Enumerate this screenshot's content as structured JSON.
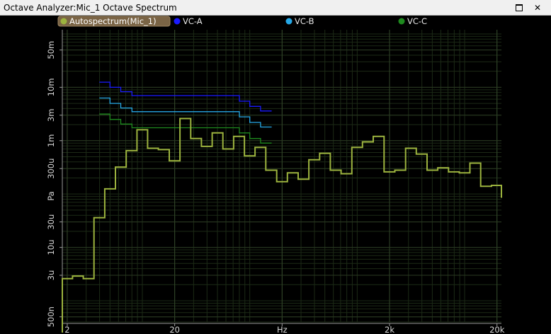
{
  "window": {
    "title": "Octave Analyzer:Mic_1 Octave Spectrum",
    "maximize_label": "",
    "close_label": "✕"
  },
  "legend": [
    {
      "label": "Autospectrum(Mic_1)",
      "color": "#9cb33e",
      "selected": true
    },
    {
      "label": "VC-A",
      "color": "#1a1aff",
      "selected": false
    },
    {
      "label": "VC-B",
      "color": "#26a9e8",
      "selected": false
    },
    {
      "label": "VC-C",
      "color": "#1e8a1e",
      "selected": false
    }
  ],
  "chart_data": {
    "type": "line",
    "xlabel": "Hz",
    "ylabel": "Pa",
    "x_scale": "log",
    "y_scale": "log",
    "xlim": [
      1.8,
      22000
    ],
    "ylim": [
      4e-07,
      0.12
    ],
    "x_ticks": [
      {
        "value": 2,
        "label": "2"
      },
      {
        "value": 20,
        "label": "20"
      },
      {
        "value": 200,
        "label": "Hz"
      },
      {
        "value": 2000,
        "label": "2k"
      },
      {
        "value": 20000,
        "label": "20k"
      }
    ],
    "y_ticks": [
      {
        "value": 0.05,
        "label": "50m"
      },
      {
        "value": 0.01,
        "label": "10m"
      },
      {
        "value": 0.003,
        "label": "3m"
      },
      {
        "value": 0.001,
        "label": "1m"
      },
      {
        "value": 0.0003,
        "label": "300u"
      },
      {
        "value": 3e-05,
        "label": "30u"
      },
      {
        "value": 1e-05,
        "label": "10u"
      },
      {
        "value": 3e-06,
        "label": "3u"
      },
      {
        "value": 5e-07,
        "label": "500n"
      }
    ],
    "grid": true,
    "legend_position": "top",
    "series": [
      {
        "name": "Autospectrum(Mic_1)",
        "color": "#9cb33e",
        "points": [
          [
            1.78,
            2.5e-07
          ],
          [
            1.78,
            2.6e-06
          ],
          [
            2.24,
            2.6e-06
          ],
          [
            2.24,
            2.9e-06
          ],
          [
            2.82,
            2.9e-06
          ],
          [
            2.82,
            2.6e-06
          ],
          [
            3.55,
            2.6e-06
          ],
          [
            3.55,
            3.6e-05
          ],
          [
            4.47,
            3.6e-05
          ],
          [
            4.47,
            0.000125
          ],
          [
            5.62,
            0.000125
          ],
          [
            5.62,
            0.00032
          ],
          [
            7.08,
            0.00032
          ],
          [
            7.08,
            0.00065
          ],
          [
            8.91,
            0.00065
          ],
          [
            8.91,
            0.0016
          ],
          [
            11.2,
            0.0016
          ],
          [
            11.2,
            0.00072
          ],
          [
            14.1,
            0.00072
          ],
          [
            14.1,
            0.00068
          ],
          [
            17.8,
            0.00068
          ],
          [
            17.8,
            0.00042
          ],
          [
            22.4,
            0.00042
          ],
          [
            22.4,
            0.0026
          ],
          [
            28.2,
            0.0026
          ],
          [
            28.2,
            0.0011
          ],
          [
            35.5,
            0.0011
          ],
          [
            35.5,
            0.00078
          ],
          [
            44.7,
            0.00078
          ],
          [
            44.7,
            0.0014
          ],
          [
            56.2,
            0.0014
          ],
          [
            56.2,
            0.0007
          ],
          [
            70.8,
            0.0007
          ],
          [
            70.8,
            0.0012
          ],
          [
            89.1,
            0.0012
          ],
          [
            89.1,
            0.00052
          ],
          [
            112,
            0.00052
          ],
          [
            112,
            0.00075
          ],
          [
            141,
            0.00075
          ],
          [
            141,
            0.00028
          ],
          [
            178,
            0.00028
          ],
          [
            178,
            0.00017
          ],
          [
            224,
            0.00017
          ],
          [
            224,
            0.00025
          ],
          [
            282,
            0.00025
          ],
          [
            282,
            0.00019
          ],
          [
            355,
            0.00019
          ],
          [
            355,
            0.00044
          ],
          [
            447,
            0.00044
          ],
          [
            447,
            0.00058
          ],
          [
            562,
            0.00058
          ],
          [
            562,
            0.00028
          ],
          [
            708,
            0.00028
          ],
          [
            708,
            0.00024
          ],
          [
            891,
            0.00024
          ],
          [
            891,
            0.00075
          ],
          [
            1120,
            0.00075
          ],
          [
            1120,
            0.00095
          ],
          [
            1410,
            0.00095
          ],
          [
            1410,
            0.0012
          ],
          [
            1780,
            0.0012
          ],
          [
            1780,
            0.00026
          ],
          [
            2240,
            0.00026
          ],
          [
            2240,
            0.00028
          ],
          [
            2820,
            0.00028
          ],
          [
            2820,
            0.00072
          ],
          [
            3550,
            0.00072
          ],
          [
            3550,
            0.00056
          ],
          [
            4470,
            0.00056
          ],
          [
            4470,
            0.00028
          ],
          [
            5620,
            0.00028
          ],
          [
            5620,
            0.00031
          ],
          [
            7080,
            0.00031
          ],
          [
            7080,
            0.00026
          ],
          [
            8910,
            0.00026
          ],
          [
            8910,
            0.00025
          ],
          [
            11200,
            0.00025
          ],
          [
            11200,
            0.00038
          ],
          [
            14100,
            0.00038
          ],
          [
            14100,
            0.00014
          ],
          [
            17800,
            0.00014
          ],
          [
            17800,
            0.000145
          ],
          [
            22400,
            0.000145
          ],
          [
            22400,
            8.5e-05
          ],
          [
            27000,
            8.5e-05
          ]
        ]
      },
      {
        "name": "VC-A",
        "color": "#1a1aff",
        "points": [
          [
            3.98,
            0.0125
          ],
          [
            5,
            0.0125
          ],
          [
            5,
            0.01
          ],
          [
            6.3,
            0.01
          ],
          [
            6.3,
            0.0083
          ],
          [
            8,
            0.0083
          ],
          [
            8,
            0.007
          ],
          [
            80,
            0.007
          ],
          [
            80,
            0.0055
          ],
          [
            100,
            0.0055
          ],
          [
            100,
            0.0044
          ],
          [
            126,
            0.0044
          ],
          [
            126,
            0.0036
          ],
          [
            160,
            0.0036
          ]
        ]
      },
      {
        "name": "VC-B",
        "color": "#26a9e8",
        "points": [
          [
            3.98,
            0.0063
          ],
          [
            5,
            0.0063
          ],
          [
            5,
            0.005
          ],
          [
            6.3,
            0.005
          ],
          [
            6.3,
            0.0041
          ],
          [
            8,
            0.0041
          ],
          [
            8,
            0.0035
          ],
          [
            80,
            0.0035
          ],
          [
            80,
            0.0028
          ],
          [
            100,
            0.0028
          ],
          [
            100,
            0.0022
          ],
          [
            126,
            0.0022
          ],
          [
            126,
            0.0018
          ],
          [
            160,
            0.0018
          ]
        ]
      },
      {
        "name": "VC-C",
        "color": "#1e8a1e",
        "points": [
          [
            3.98,
            0.00315
          ],
          [
            5,
            0.00315
          ],
          [
            5,
            0.0025
          ],
          [
            6.3,
            0.0025
          ],
          [
            6.3,
            0.00205
          ],
          [
            8,
            0.00205
          ],
          [
            8,
            0.00175
          ],
          [
            80,
            0.00175
          ],
          [
            80,
            0.0014
          ],
          [
            100,
            0.0014
          ],
          [
            100,
            0.0011
          ],
          [
            126,
            0.0011
          ],
          [
            126,
            0.0009
          ],
          [
            160,
            0.0009
          ]
        ]
      }
    ]
  }
}
